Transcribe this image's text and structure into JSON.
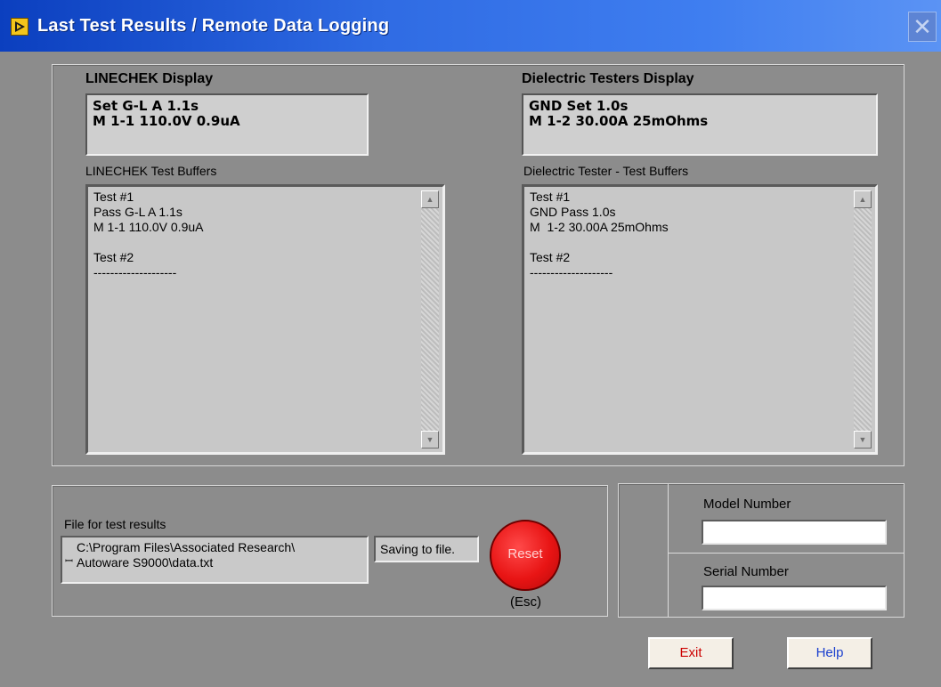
{
  "window": {
    "title": "Last Test Results / Remote Data Logging",
    "close_glyph": "✕"
  },
  "linechek": {
    "display_label": "LINECHEK Display",
    "display_lines": [
      "Set G-L A 1.1s",
      "M 1-1 110.0V 0.9uA"
    ],
    "buffers_label": "LINECHEK Test Buffers",
    "buffer_text": "Test #1\nPass G-L A 1.1s\nM 1-1 110.0V 0.9uA\n\nTest #2\n--------------------"
  },
  "dielectric": {
    "display_label": "Dielectric Testers Display",
    "display_lines": [
      "GND Set 1.0s",
      "M  1-2 30.00A 25mOhms"
    ],
    "buffers_label": "Dielectric Tester - Test Buffers",
    "buffer_text": "Test #1\nGND Pass 1.0s\nM  1-2 30.00A 25mOhms\n\nTest #2\n--------------------"
  },
  "file": {
    "label": "File for test results",
    "path_line1": "C:\\Program Files\\Associated Research\\",
    "path_line2": "Autoware S9000\\data.txt",
    "status": "Saving to file.",
    "path_icon": "path-icon"
  },
  "reset": {
    "label": "Reset",
    "shortcut": "(Esc)"
  },
  "model": {
    "label": "Model Number",
    "value": ""
  },
  "serial": {
    "label": "Serial Number",
    "value": ""
  },
  "buttons": {
    "exit": "Exit",
    "help": "Help"
  },
  "colors": {
    "reset_red": "#e81414",
    "titlebar_blue": "#2f6be3",
    "exit_text": "#cc0000",
    "help_text": "#1a3fcf"
  },
  "icons": [
    "labview-run-icon",
    "close-icon",
    "scroll-up-icon",
    "scroll-down-icon",
    "path-icon"
  ]
}
